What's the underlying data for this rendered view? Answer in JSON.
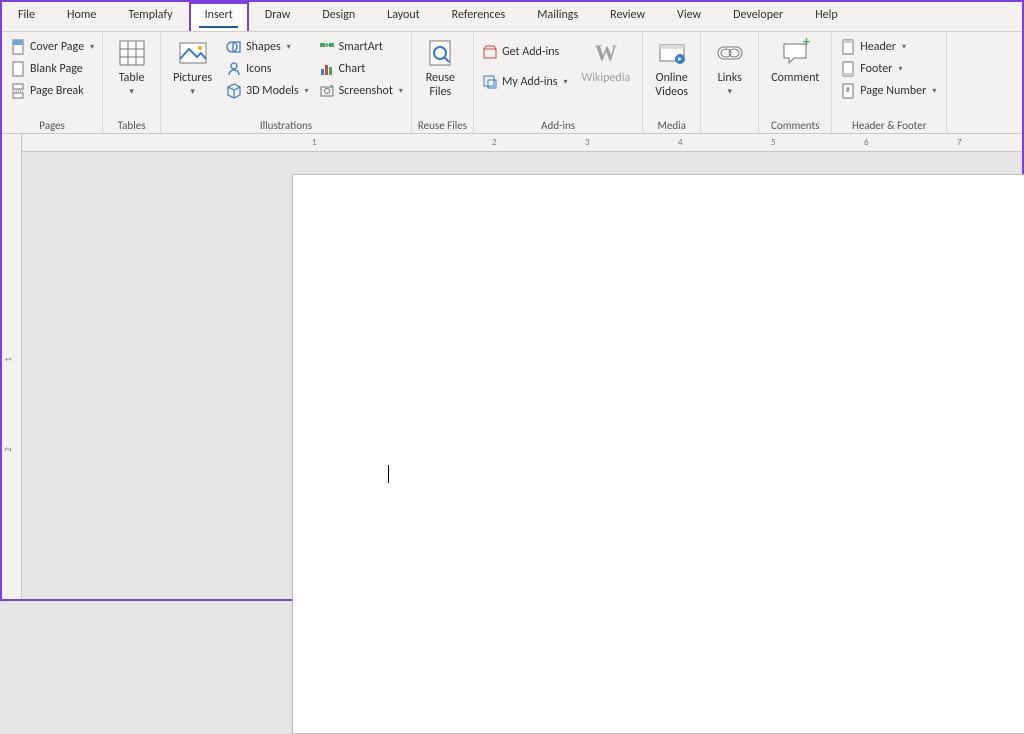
{
  "tabs": {
    "file": "File",
    "home": "Home",
    "templafy": "Templafy",
    "insert": "Insert",
    "draw": "Draw",
    "design": "Design",
    "layout": "Layout",
    "references": "References",
    "mailings": "Mailings",
    "review": "Review",
    "view": "View",
    "developer": "Developer",
    "help": "Help"
  },
  "groups": {
    "pages": {
      "label": "Pages",
      "cover_page": "Cover Page",
      "blank_page": "Blank Page",
      "page_break": "Page Break"
    },
    "tables": {
      "label": "Tables",
      "table": "Table"
    },
    "illustrations": {
      "label": "Illustrations",
      "pictures": "Pictures",
      "shapes": "Shapes",
      "icons": "Icons",
      "models3d": "3D Models",
      "smartart": "SmartArt",
      "chart": "Chart",
      "screenshot": "Screenshot"
    },
    "reuse": {
      "label": "Reuse Files",
      "reuse_files": "Reuse\nFiles"
    },
    "addins": {
      "label": "Add-ins",
      "get": "Get Add-ins",
      "my": "My Add-ins",
      "wikipedia": "Wikipedia"
    },
    "media": {
      "label": "Media",
      "online_videos": "Online\nVideos"
    },
    "links": {
      "label": "",
      "links": "Links"
    },
    "comments": {
      "label": "Comments",
      "comment": "Comment"
    },
    "header_footer": {
      "label": "Header & Footer",
      "header": "Header",
      "footer": "Footer",
      "page_number": "Page Number"
    }
  },
  "ruler": {
    "h": [
      "1",
      "2",
      "3",
      "4",
      "5",
      "6",
      "7"
    ],
    "v": [
      "1",
      "2"
    ]
  }
}
